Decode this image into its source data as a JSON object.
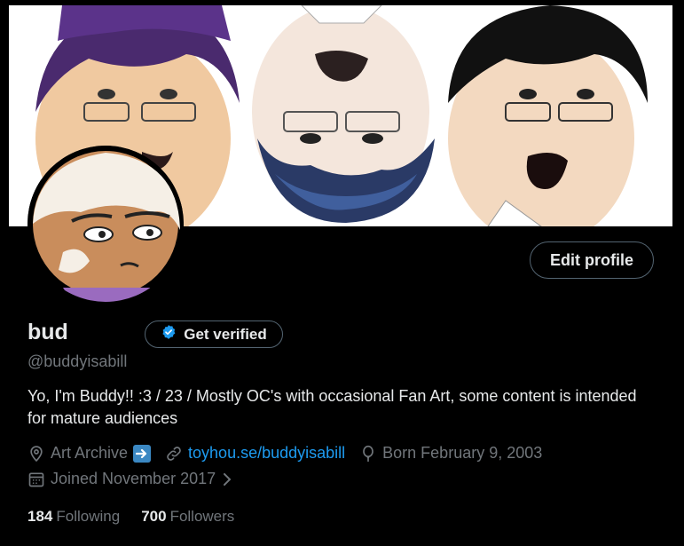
{
  "profile": {
    "display_name": "bud",
    "handle": "@buddyisabill",
    "bio": "Yo, I'm Buddy!! :3 / 23 / Mostly OC's with occasional Fan Art, some content is intended for mature audiences",
    "location": "Art Archive",
    "website": "toyhou.se/buddyisabill",
    "birthday": "Born February 9, 2003",
    "joined": "Joined November 2017"
  },
  "buttons": {
    "edit_profile": "Edit profile",
    "get_verified": "Get verified"
  },
  "stats": {
    "following_count": "184",
    "following_label": "Following",
    "followers_count": "700",
    "followers_label": "Followers"
  },
  "icons": {
    "location": "location-pin-icon",
    "location_emoji": "right-arrow-emoji-icon",
    "website": "link-icon",
    "birthday": "balloon-icon",
    "joined": "calendar-icon",
    "joined_chevron": "chevron-right-icon",
    "verified": "verified-badge-icon"
  },
  "colors": {
    "background": "#000000",
    "text_primary": "#e7e9ea",
    "text_secondary": "#71767b",
    "link": "#1d9bf0",
    "border": "#536471"
  }
}
